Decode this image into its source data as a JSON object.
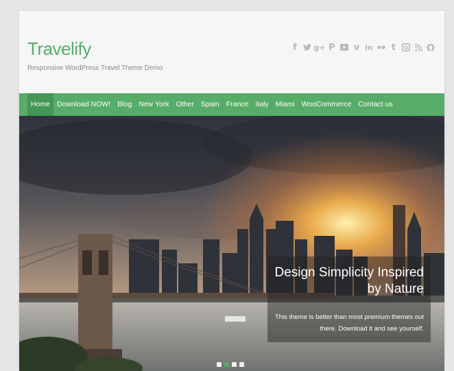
{
  "site": {
    "title": "Travelify",
    "tagline": "Responsive WordPress Travel Theme Demo"
  },
  "social": [
    "facebook-icon",
    "twitter-icon",
    "googleplus-icon",
    "pinterest-icon",
    "youtube-icon",
    "vimeo-icon",
    "linkedin-icon",
    "flickr-icon",
    "tumblr-icon",
    "instagram-icon",
    "rss-icon",
    "github-icon"
  ],
  "nav": {
    "items": [
      {
        "label": "Home",
        "active": true
      },
      {
        "label": "Download NOW!"
      },
      {
        "label": "Blog"
      },
      {
        "label": "New York"
      },
      {
        "label": "Other"
      },
      {
        "label": "Spain"
      },
      {
        "label": "France"
      },
      {
        "label": "Italy"
      },
      {
        "label": "Miami"
      },
      {
        "label": "WooCommerce"
      },
      {
        "label": "Contact us"
      }
    ]
  },
  "slider": {
    "title": "Design Simplicity Inspired by Nature",
    "text": "This theme is better than most premium themes out there. Download it and see yourself.",
    "slide_count": 4,
    "active_slide": 2
  },
  "colors": {
    "brand": "#57ad68",
    "nav_active": "#439656"
  }
}
